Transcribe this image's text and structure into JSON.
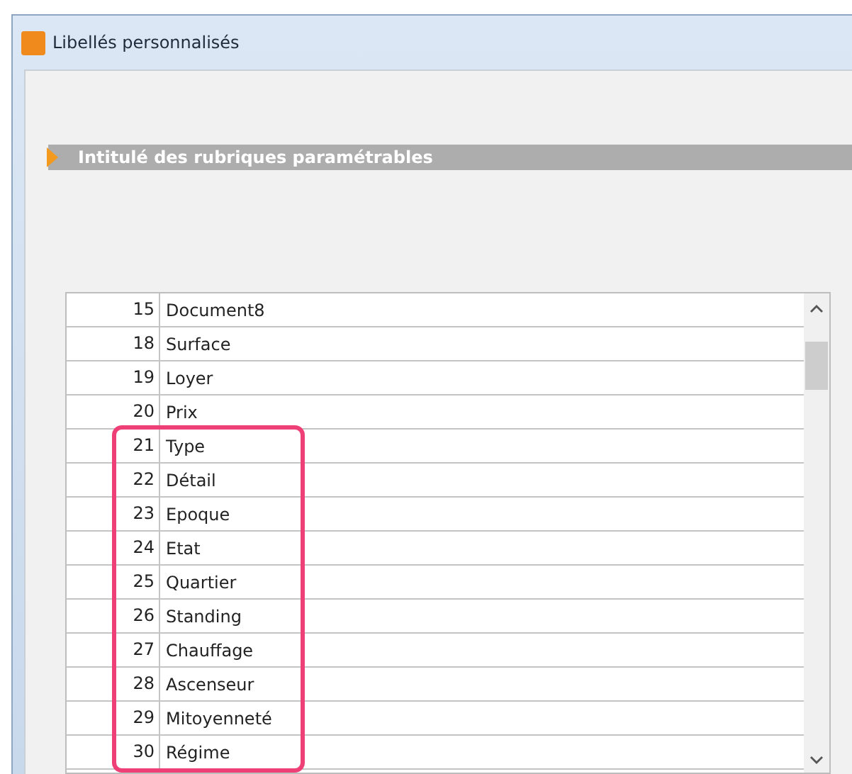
{
  "window": {
    "title": "Libellés personnalisés"
  },
  "section": {
    "title": "Intitulé des rubriques paramétrables"
  },
  "table": {
    "rows": [
      {
        "number": "15",
        "label": "Document8",
        "highlighted": false
      },
      {
        "number": "18",
        "label": "Surface",
        "highlighted": false
      },
      {
        "number": "19",
        "label": "Loyer",
        "highlighted": false
      },
      {
        "number": "20",
        "label": "Prix",
        "highlighted": false
      },
      {
        "number": "21",
        "label": "Type",
        "highlighted": true
      },
      {
        "number": "22",
        "label": "Détail",
        "highlighted": true
      },
      {
        "number": "23",
        "label": "Epoque",
        "highlighted": true
      },
      {
        "number": "24",
        "label": "Etat",
        "highlighted": true
      },
      {
        "number": "25",
        "label": "Quartier",
        "highlighted": true
      },
      {
        "number": "26",
        "label": "Standing",
        "highlighted": true
      },
      {
        "number": "27",
        "label": "Chauffage",
        "highlighted": true
      },
      {
        "number": "28",
        "label": "Ascenseur",
        "highlighted": true
      },
      {
        "number": "29",
        "label": "Mitoyenneté",
        "highlighted": true
      },
      {
        "number": "30",
        "label": "Régime",
        "highlighted": true
      }
    ]
  }
}
